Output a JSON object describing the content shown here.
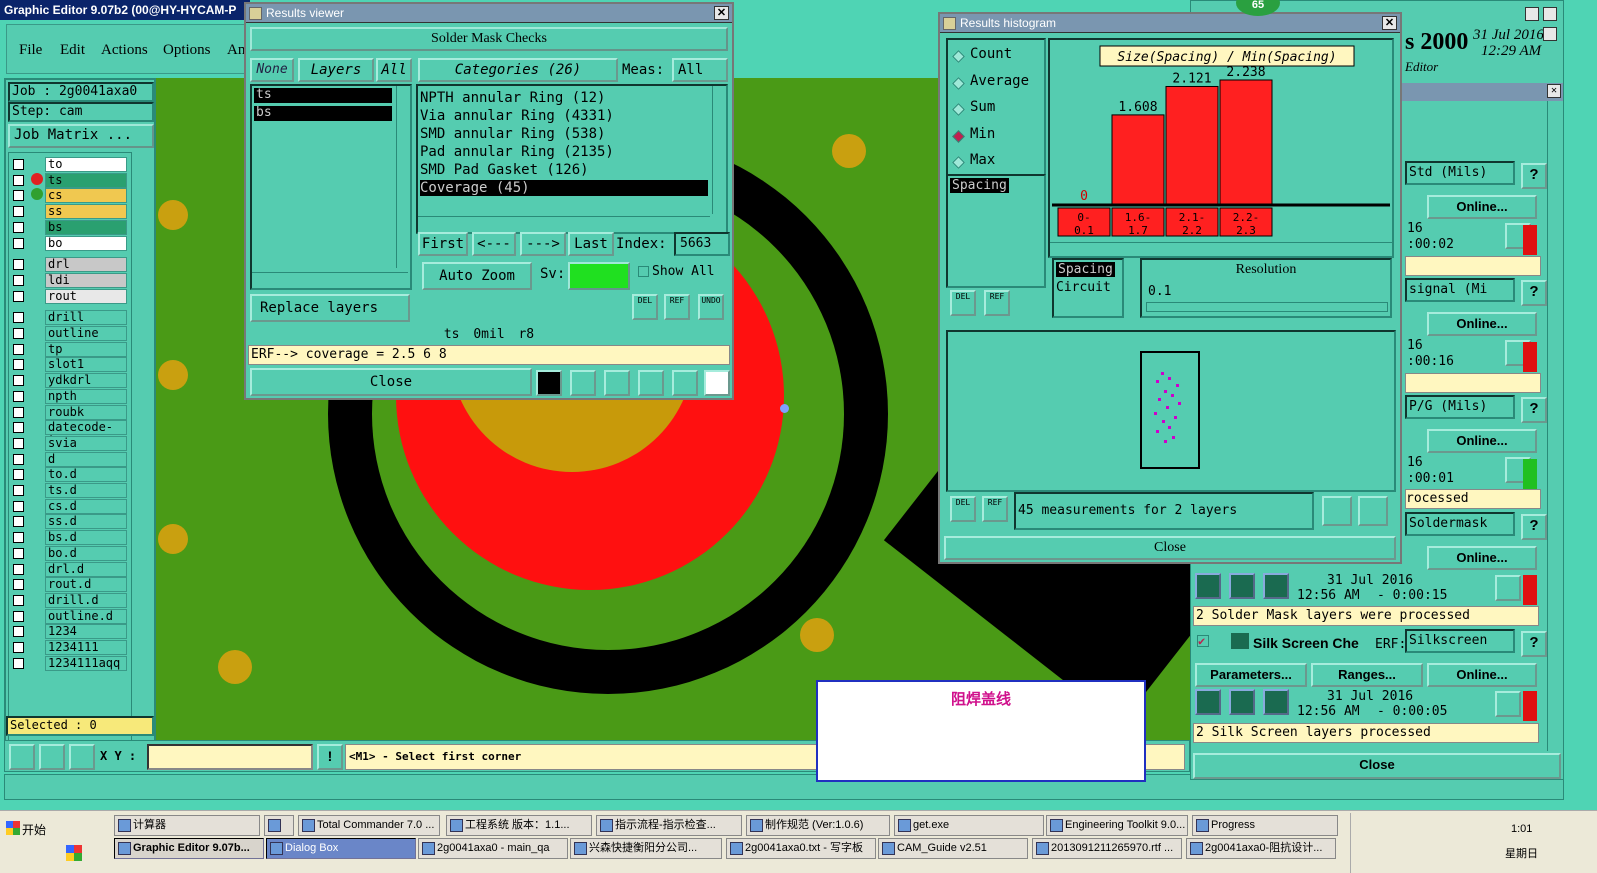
{
  "main_window": {
    "title": "Graphic Editor 9.07b2 (00@HY-HYCAM-P",
    "menu": [
      "File",
      "Edit",
      "Actions",
      "Options",
      "An"
    ],
    "job_label": "Job : 2g0041axa0",
    "step_label": "Step: cam",
    "job_matrix_button": "Job Matrix ...",
    "layers": [
      "to",
      "ts",
      "cs",
      "ss",
      "bs",
      "bo",
      "drl",
      "ldi",
      "rout",
      "drill",
      "outline",
      "tp",
      "slot1",
      "ydkdrl",
      "npth",
      "roubk",
      "datecode-to",
      "svia",
      "d",
      "to.d",
      "ts.d",
      "cs.d",
      "ss.d",
      "bs.d",
      "bo.d",
      "drl.d",
      "rout.d",
      "drill.d",
      "outline.d",
      "1234",
      "1234111",
      "1234111aqq"
    ],
    "selected_label": "Selected : 0",
    "xy_label": "X Y :",
    "status_message": "<M1> - Select first corner"
  },
  "results_viewer": {
    "title": "Results viewer",
    "header": "Solder Mask Checks",
    "tabs": {
      "none": "None",
      "layers": "Layers",
      "all": "All"
    },
    "layer_items": [
      "ts",
      "bs"
    ],
    "categories_label": "Categories (26)",
    "meas_label": "Meas:",
    "meas_value": "All",
    "categories": [
      "NPTH annular Ring (12)",
      "Via annular Ring (4331)",
      "SMD annular Ring (538)",
      "Pad annular Ring (2135)",
      "SMD Pad Gasket (126)",
      "Coverage (45)"
    ],
    "nav": {
      "first": "First",
      "prev": "<---",
      "next": "--->",
      "last": "Last",
      "index_label": "Index:",
      "index_value": "5663"
    },
    "auto_zoom": "Auto Zoom",
    "sv_label": "Sv:",
    "show_all": "Show All",
    "replace_layers": "Replace layers",
    "icon_labels": {
      "del": "DEL",
      "ref": "REF",
      "undo": "UNDO"
    },
    "info_line": "ts 0mil r8",
    "erf_line": "ERF--> coverage = 2.5 6 8",
    "close": "Close"
  },
  "histogram": {
    "title": "Results histogram",
    "badge": "65",
    "options": [
      "Count",
      "Average",
      "Sum",
      "Min",
      "Max"
    ],
    "selected_option": "Min",
    "chart_title": "Size(Spacing) / Min(Spacing)",
    "list_items": [
      "Spacing"
    ],
    "list_items_2": [
      "Spacing",
      "Circuit"
    ],
    "resolution_label": "Resolution",
    "resolution_value": "0.1",
    "summary": "45 measurements for 2 layers",
    "close": "Close",
    "icon_labels": {
      "del": "DEL",
      "ref": "REF"
    }
  },
  "chart_data": {
    "type": "bar",
    "title": "Size(Spacing) / Min(Spacing)",
    "categories": [
      "0-0.1",
      "1.6-1.7",
      "2.1-2.2",
      "2.2-2.3"
    ],
    "values": [
      0,
      1.608,
      2.121,
      2.238
    ],
    "value_labels": [
      "0",
      "1.608",
      "2.121",
      "2.238"
    ],
    "bar_color": "#ff2020"
  },
  "checklist": {
    "header_right": "s 2000",
    "date": "31 Jul 2016",
    "time": "12:29 AM",
    "editor": "Editor",
    "rows": [
      {
        "erf": "Std (Mils)",
        "time": "16",
        "elapsed": ":00:02"
      },
      {
        "erf": "signal (Mi",
        "time": "16",
        "elapsed": ":00:16"
      },
      {
        "erf": "P/G (Mils)",
        "time": "16",
        "elapsed": ":00:01",
        "status": "rocessed"
      },
      {
        "erf": "Soldermask",
        "date": "31 Jul 2016",
        "time": "12:56 AM",
        "elapsed": "- 0:00:15",
        "status": "2 Solder Mask layers were processed"
      },
      {
        "check_name": "Silk Screen Che",
        "erf_label": "ERF:",
        "erf": "Silkscreen",
        "date": "31 Jul 2016",
        "time": "12:56 AM",
        "elapsed": "- 0:00:05",
        "status": "2 Silk Screen layers processed"
      }
    ],
    "online": "Online...",
    "parameters": "Parameters...",
    "ranges": "Ranges...",
    "close": "Close"
  },
  "dialog": {
    "text": "阻焊盖线"
  },
  "taskbar": {
    "start": "开始",
    "row1": [
      "计算器",
      "",
      "Total Commander 7.0 ...",
      "工程系统 版本：1.1...",
      "指示流程-指示检查...",
      "制作规范 (Ver:1.0.6)",
      "get.exe",
      "Engineering Toolkit 9.0...",
      "Progress"
    ],
    "row2": [
      "Graphic Editor 9.07b...",
      "Dialog Box",
      "2g0041axa0 - main_qa",
      "兴森快捷衡阳分公司...",
      "2g0041axa0.txt - 写字板",
      "CAM_Guide v2.51",
      "2013091211265970.rtf ...",
      "2g0041axa0-阻抗设计..."
    ],
    "clock": "1:01",
    "day": "星期日"
  }
}
